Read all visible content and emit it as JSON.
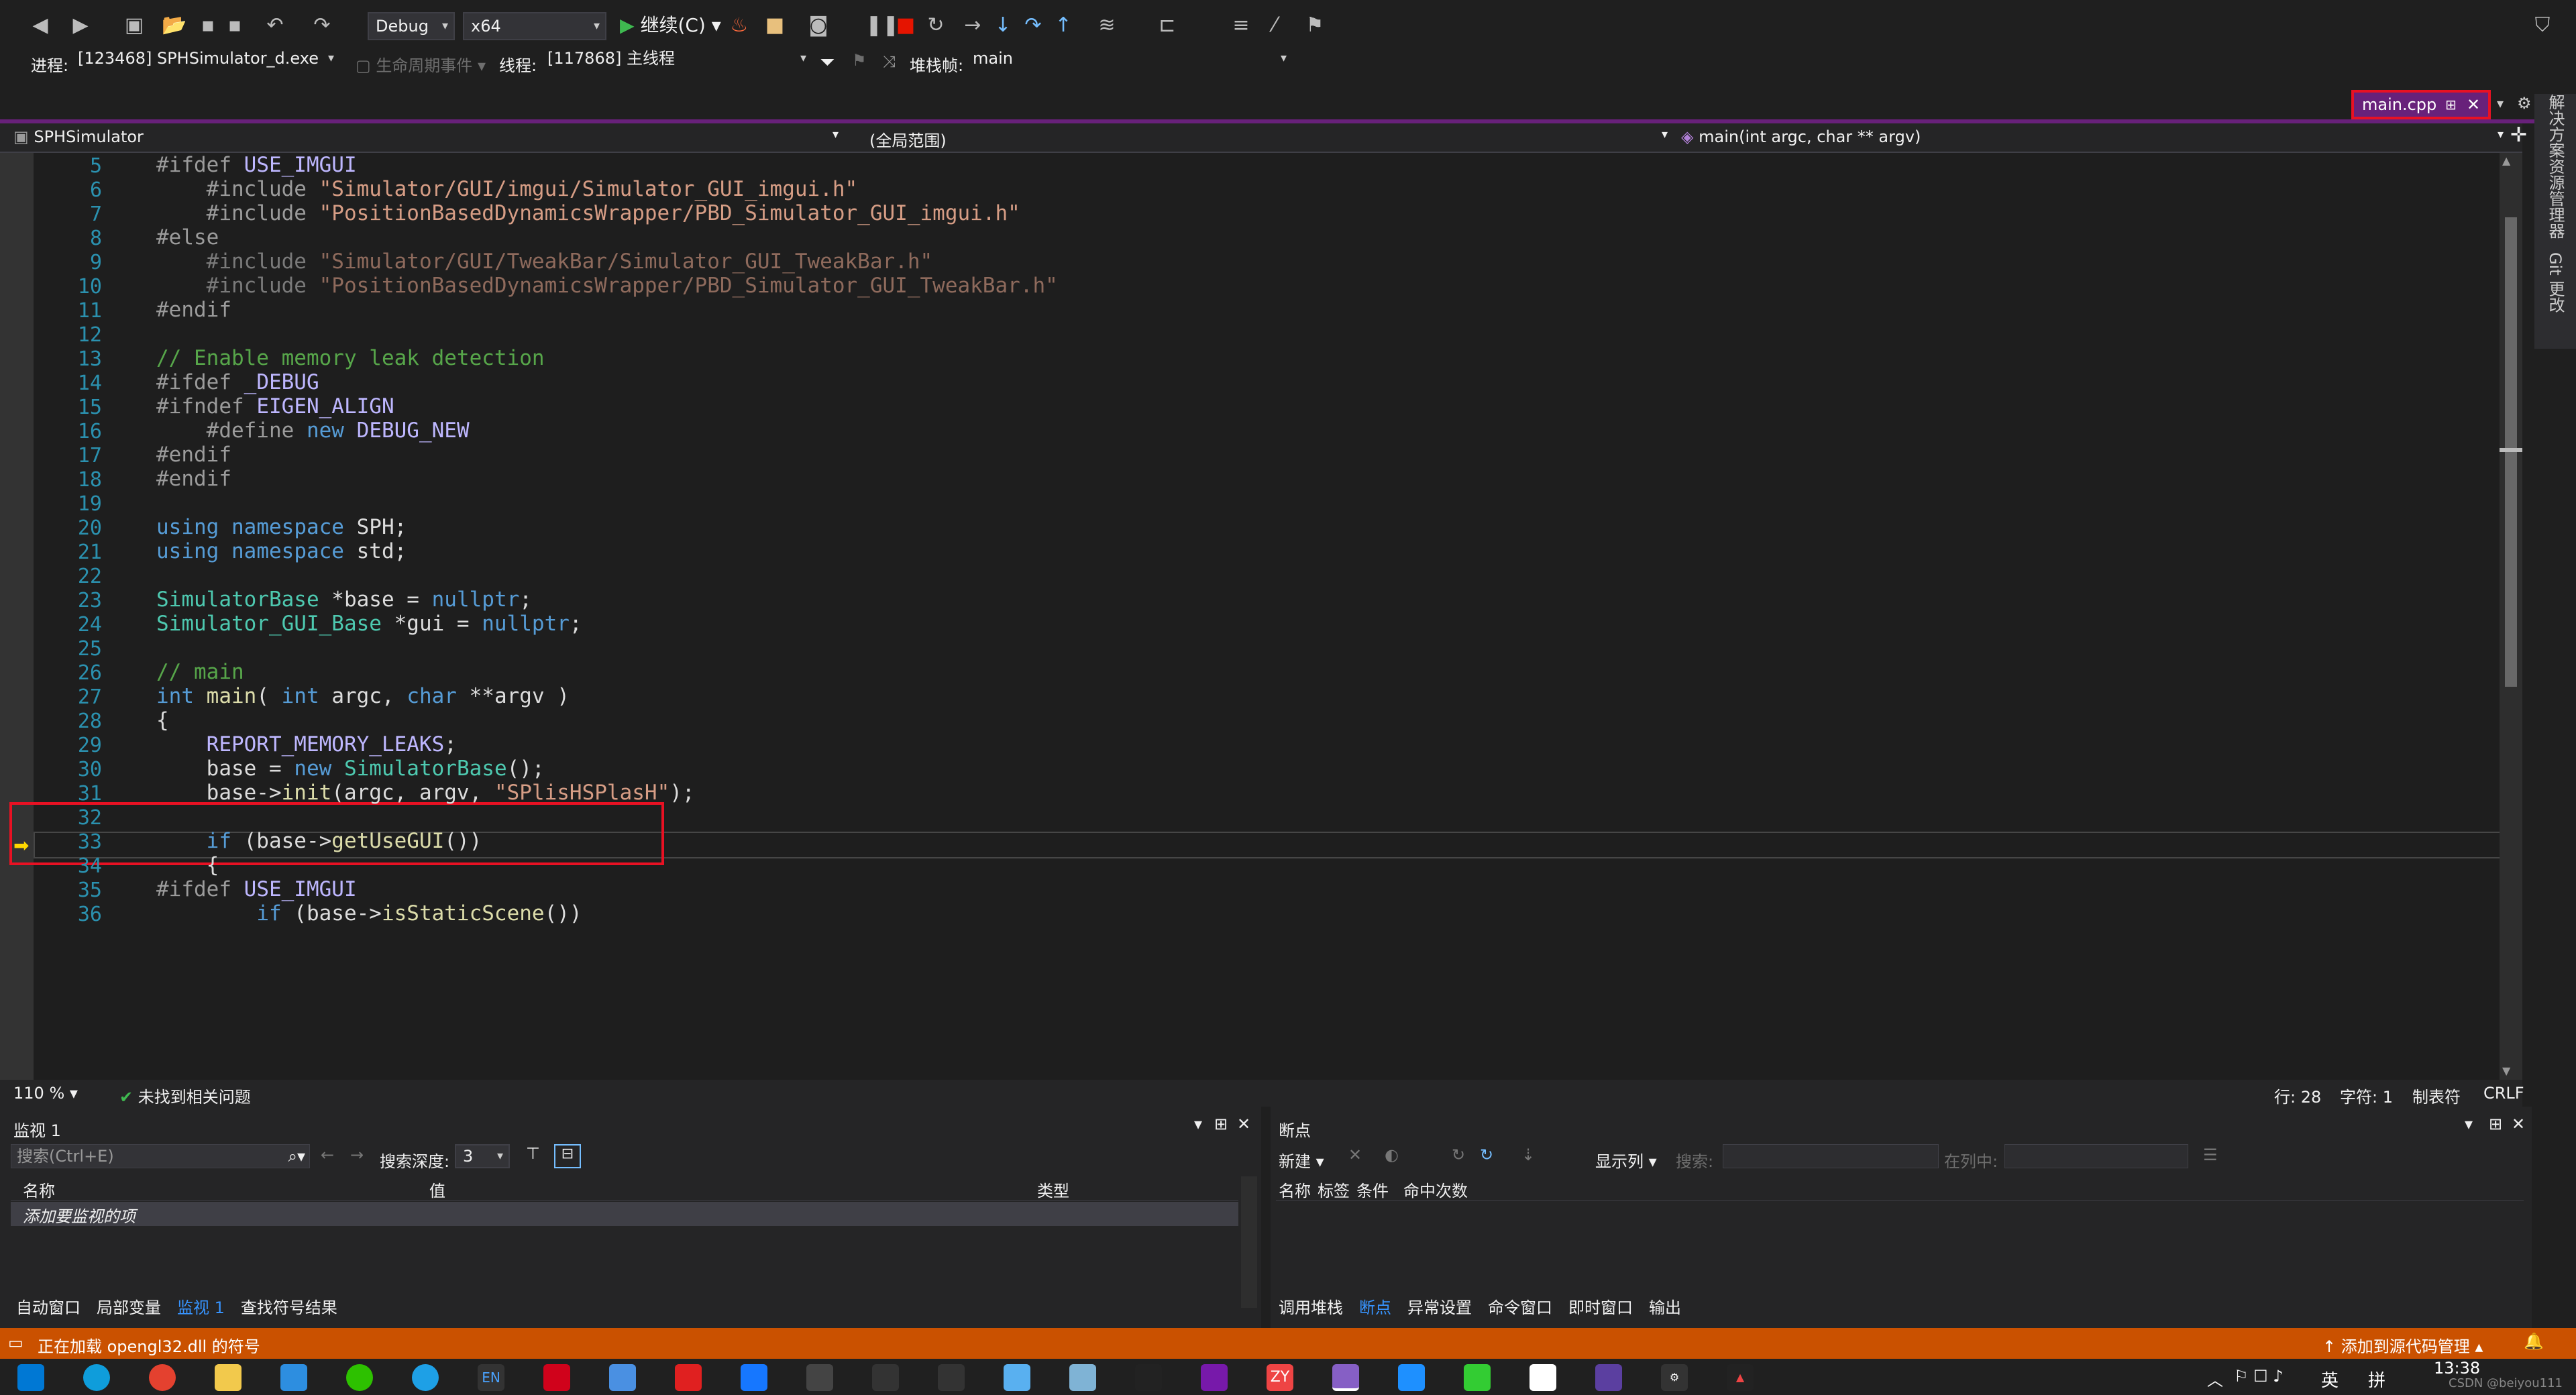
{
  "toolbar": {
    "config": "Debug",
    "platform": "x64",
    "continue_label": "继续(C)"
  },
  "debugbar": {
    "process_label": "进程:",
    "process_value": "[123468] SPHSimulator_d.exe",
    "lifecycle_label": "生命周期事件",
    "thread_label": "线程:",
    "thread_value": "[117868] 主线程",
    "stack_label": "堆栈帧:",
    "stack_value": "main"
  },
  "doc_tab": {
    "name": "main.cpp"
  },
  "navbar": {
    "project": "SPHSimulator",
    "scope": "(全局范围)",
    "function": "main(int argc, char ** argv)"
  },
  "side_tabs": [
    "解决方案资源管理器",
    "Git 更改"
  ],
  "code_lines": [
    {
      "n": "5",
      "t": "#ifdef USE_IMGUI"
    },
    {
      "n": "6",
      "t": "    #include \"Simulator/GUI/imgui/Simulator_GUI_imgui.h\""
    },
    {
      "n": "7",
      "t": "    #include \"PositionBasedDynamicsWrapper/PBD_Simulator_GUI_imgui.h\""
    },
    {
      "n": "8",
      "t": "#else"
    },
    {
      "n": "9",
      "t": "    #include \"Simulator/GUI/TweakBar/Simulator_GUI_TweakBar.h\""
    },
    {
      "n": "10",
      "t": "    #include \"PositionBasedDynamicsWrapper/PBD_Simulator_GUI_TweakBar.h\""
    },
    {
      "n": "11",
      "t": "#endif"
    },
    {
      "n": "12",
      "t": ""
    },
    {
      "n": "13",
      "t": "// Enable memory leak detection"
    },
    {
      "n": "14",
      "t": "#ifdef _DEBUG"
    },
    {
      "n": "15",
      "t": "#ifndef EIGEN_ALIGN"
    },
    {
      "n": "16",
      "t": "    #define new DEBUG_NEW"
    },
    {
      "n": "17",
      "t": "#endif"
    },
    {
      "n": "18",
      "t": "#endif"
    },
    {
      "n": "19",
      "t": ""
    },
    {
      "n": "20",
      "t": "using namespace SPH;"
    },
    {
      "n": "21",
      "t": "using namespace std;"
    },
    {
      "n": "22",
      "t": ""
    },
    {
      "n": "23",
      "t": "SimulatorBase *base = nullptr;"
    },
    {
      "n": "24",
      "t": "Simulator_GUI_Base *gui = nullptr;"
    },
    {
      "n": "25",
      "t": ""
    },
    {
      "n": "26",
      "t": "// main"
    },
    {
      "n": "27",
      "t": "int main( int argc, char **argv )"
    },
    {
      "n": "28",
      "t": "{"
    },
    {
      "n": "29",
      "t": "    REPORT_MEMORY_LEAKS;"
    },
    {
      "n": "30",
      "t": "    base = new SimulatorBase();"
    },
    {
      "n": "31",
      "t": "    base->init(argc, argv, \"SPlisHSPlasH\");"
    },
    {
      "n": "32",
      "t": ""
    },
    {
      "n": "33",
      "t": "    if (base->getUseGUI())"
    },
    {
      "n": "34",
      "t": "    {"
    },
    {
      "n": "35",
      "t": "#ifdef USE_IMGUI"
    },
    {
      "n": "36",
      "t": "        if (base->isStaticScene())"
    }
  ],
  "editor_status": {
    "zoom": "110 %",
    "issues": "未找到相关问题",
    "line": "行: 28",
    "col": "字符: 1",
    "indent": "制表符",
    "eol": "CRLF"
  },
  "watch": {
    "title": "监视 1",
    "search_placeholder": "搜索(Ctrl+E)",
    "depth_label": "搜索深度:",
    "depth_value": "3",
    "col_name": "名称",
    "col_value": "值",
    "col_type": "类型",
    "add_hint": "添加要监视的项",
    "tabs": [
      "自动窗口",
      "局部变量",
      "监视 1",
      "查找符号结果"
    ]
  },
  "breakpoints": {
    "title": "断点",
    "new_label": "新建",
    "columns_label": "显示列",
    "search_label": "搜索:",
    "in_col_label": "在列中:",
    "col_name": "名称",
    "col_tag": "标签",
    "col_cond": "条件",
    "col_hits": "命中次数",
    "tabs": [
      "调用堆栈",
      "断点",
      "异常设置",
      "命令窗口",
      "即时窗口",
      "输出"
    ]
  },
  "status": {
    "message": "正在加载 opengl32.dll 的符号",
    "source_control": "添加到源代码管理"
  },
  "taskbar": {
    "lang": "英",
    "ime": "拼",
    "time": "13:38",
    "watermark": "CSDN @beiyou111"
  },
  "colors": {
    "accent": "#68217a",
    "status": "#ca5100",
    "highlight": "#e81123"
  }
}
